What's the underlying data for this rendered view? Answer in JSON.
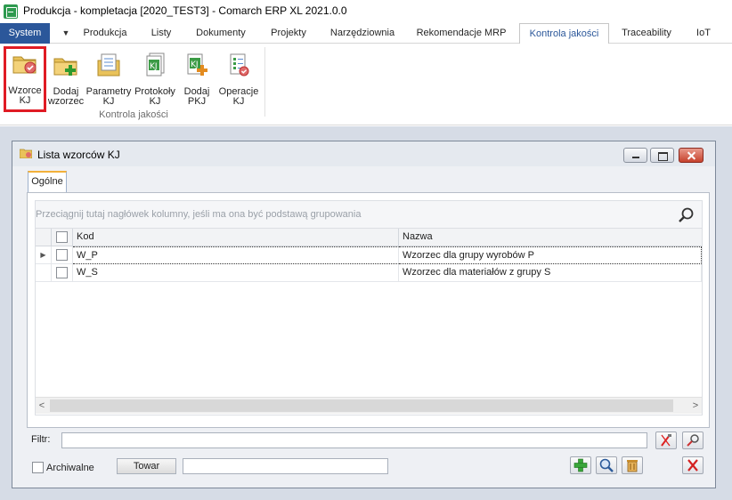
{
  "window": {
    "title": "Produkcja - kompletacja [2020_TEST3] - Comarch ERP XL 2021.0.0"
  },
  "ribbon_tabs": [
    {
      "label": "System"
    },
    {
      "label": "Produkcja"
    },
    {
      "label": "Listy"
    },
    {
      "label": "Dokumenty"
    },
    {
      "label": "Projekty"
    },
    {
      "label": "Narzędziownia"
    },
    {
      "label": "Rekomendacje MRP"
    },
    {
      "label": "Kontrola jakości"
    },
    {
      "label": "Traceability"
    },
    {
      "label": "IoT"
    }
  ],
  "active_tab": "Kontrola jakości",
  "ribbon": {
    "buttons": [
      {
        "label": "Wzorce\nKJ",
        "icon": "folder-check-icon"
      },
      {
        "label": "Dodaj\nwzorzec",
        "icon": "folder-add-icon"
      },
      {
        "label": "Parametry\nKJ",
        "icon": "parameters-list-icon"
      },
      {
        "label": "Protokoły\nKJ",
        "icon": "protocols-icon"
      },
      {
        "label": "Dodaj\nPKJ",
        "icon": "add-protocol-icon"
      },
      {
        "label": "Operacje\nKJ",
        "icon": "operations-list-icon"
      }
    ],
    "group_label": "Kontrola jakości"
  },
  "child_window": {
    "title": "Lista wzorców KJ",
    "tab": "Ogólne",
    "group_panel_hint": "Przeciągnij tutaj nagłówek kolumny, jeśli ma ona być podstawą grupowania",
    "columns": [
      "Kod",
      "Nazwa"
    ],
    "rows": [
      {
        "kod": "W_P",
        "nazwa": "Wzorzec dla grupy wyrobów P"
      },
      {
        "kod": "W_S",
        "nazwa": "Wzorzec dla materiałów z grupy S"
      }
    ],
    "filter_label": "Filtr:",
    "filter_value": "",
    "archiwalne_label": "Archiwalne",
    "towar_button": "Towar",
    "towar_value": ""
  },
  "colors": {
    "system_tab": "#2b579a",
    "highlight_border": "#e01b24",
    "workspace": "#d6dce6"
  }
}
